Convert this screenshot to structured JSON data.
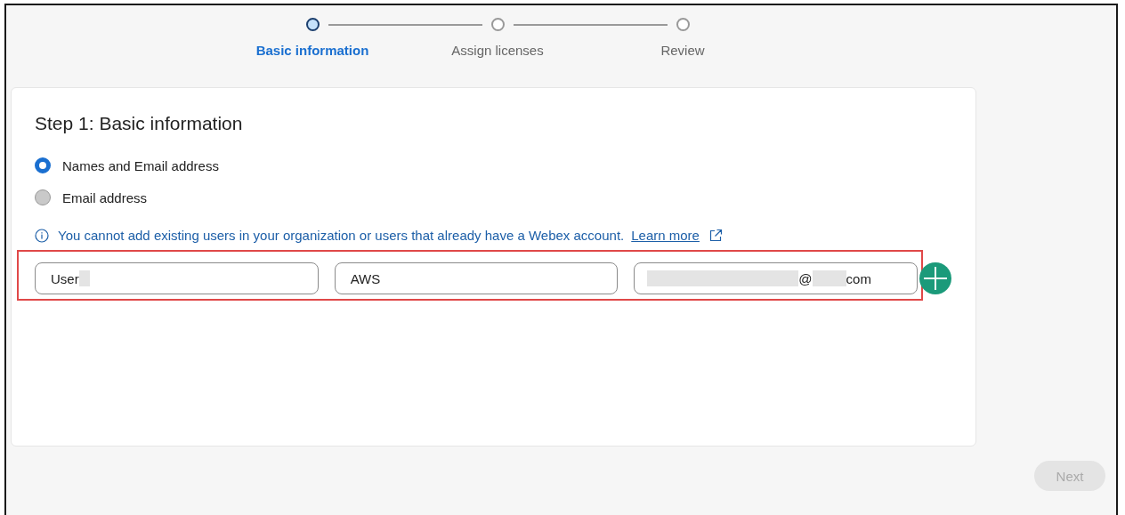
{
  "stepper": [
    {
      "label": "Basic information",
      "selected": true
    },
    {
      "label": "Assign licenses",
      "selected": false
    },
    {
      "label": "Review",
      "selected": false
    }
  ],
  "card": {
    "title": "Step 1: Basic information",
    "options": [
      {
        "label": "Names and Email address",
        "selected": true
      },
      {
        "label": "Email address",
        "selected": false
      }
    ],
    "notice": {
      "text": "You cannot add existing users in your organization or users that already have a Webex account.",
      "link": "Learn more"
    },
    "fields": [
      [
        {
          "kind": "text",
          "text": "User"
        },
        {
          "kind": "redacted"
        }
      ],
      [
        {
          "kind": "text",
          "text": "AWS"
        }
      ],
      [
        {
          "kind": "redacted"
        },
        {
          "kind": "text",
          "text": "@"
        },
        {
          "kind": "redacted"
        },
        {
          "kind": "text",
          "text": "com"
        }
      ]
    ]
  },
  "next_button": {
    "label": "Next",
    "disabled": true
  }
}
